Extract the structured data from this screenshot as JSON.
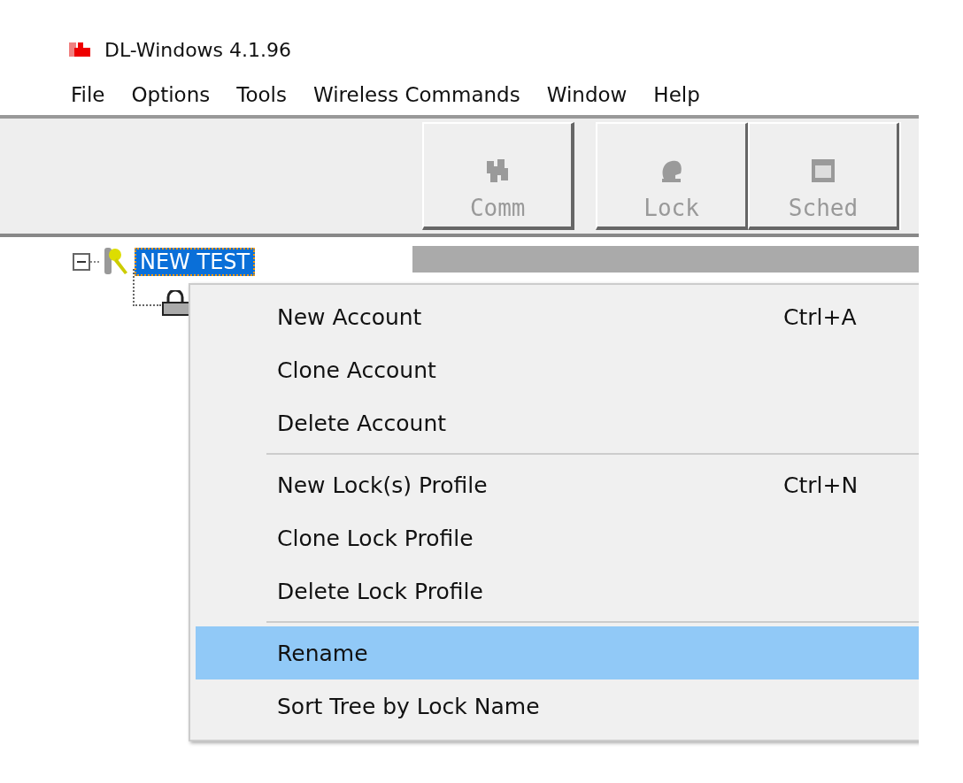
{
  "window": {
    "title": "DL-Windows 4.1.96"
  },
  "menubar": [
    "File",
    "Options",
    "Tools",
    "Wireless Commands",
    "Window",
    "Help"
  ],
  "toolbar": [
    {
      "label": "Comm",
      "kind": "comm",
      "disabled": true
    },
    {
      "label": "Lock",
      "kind": "lock",
      "disabled": true
    },
    {
      "label": "Sched",
      "kind": "sched",
      "disabled": true
    }
  ],
  "tree": {
    "label": "NEW TEST",
    "selected": true,
    "expanded": true,
    "children": [
      {
        "kind": "lock"
      }
    ]
  },
  "context_menu": [
    {
      "kind": "item",
      "label": "New Account",
      "shortcut": "Ctrl+A",
      "selected": false
    },
    {
      "kind": "item",
      "label": "Clone Account",
      "selected": false
    },
    {
      "kind": "item",
      "label": "Delete Account",
      "selected": false
    },
    {
      "kind": "separator"
    },
    {
      "kind": "item",
      "label": "New Lock(s) Profile",
      "shortcut": "Ctrl+N",
      "selected": false
    },
    {
      "kind": "item",
      "label": "Clone Lock Profile",
      "selected": false
    },
    {
      "kind": "item",
      "label": "Delete Lock Profile",
      "selected": false
    },
    {
      "kind": "separator"
    },
    {
      "kind": "item",
      "label": "Rename",
      "selected": true
    },
    {
      "kind": "item",
      "label": "Sort Tree by Lock Name",
      "selected": false
    }
  ]
}
